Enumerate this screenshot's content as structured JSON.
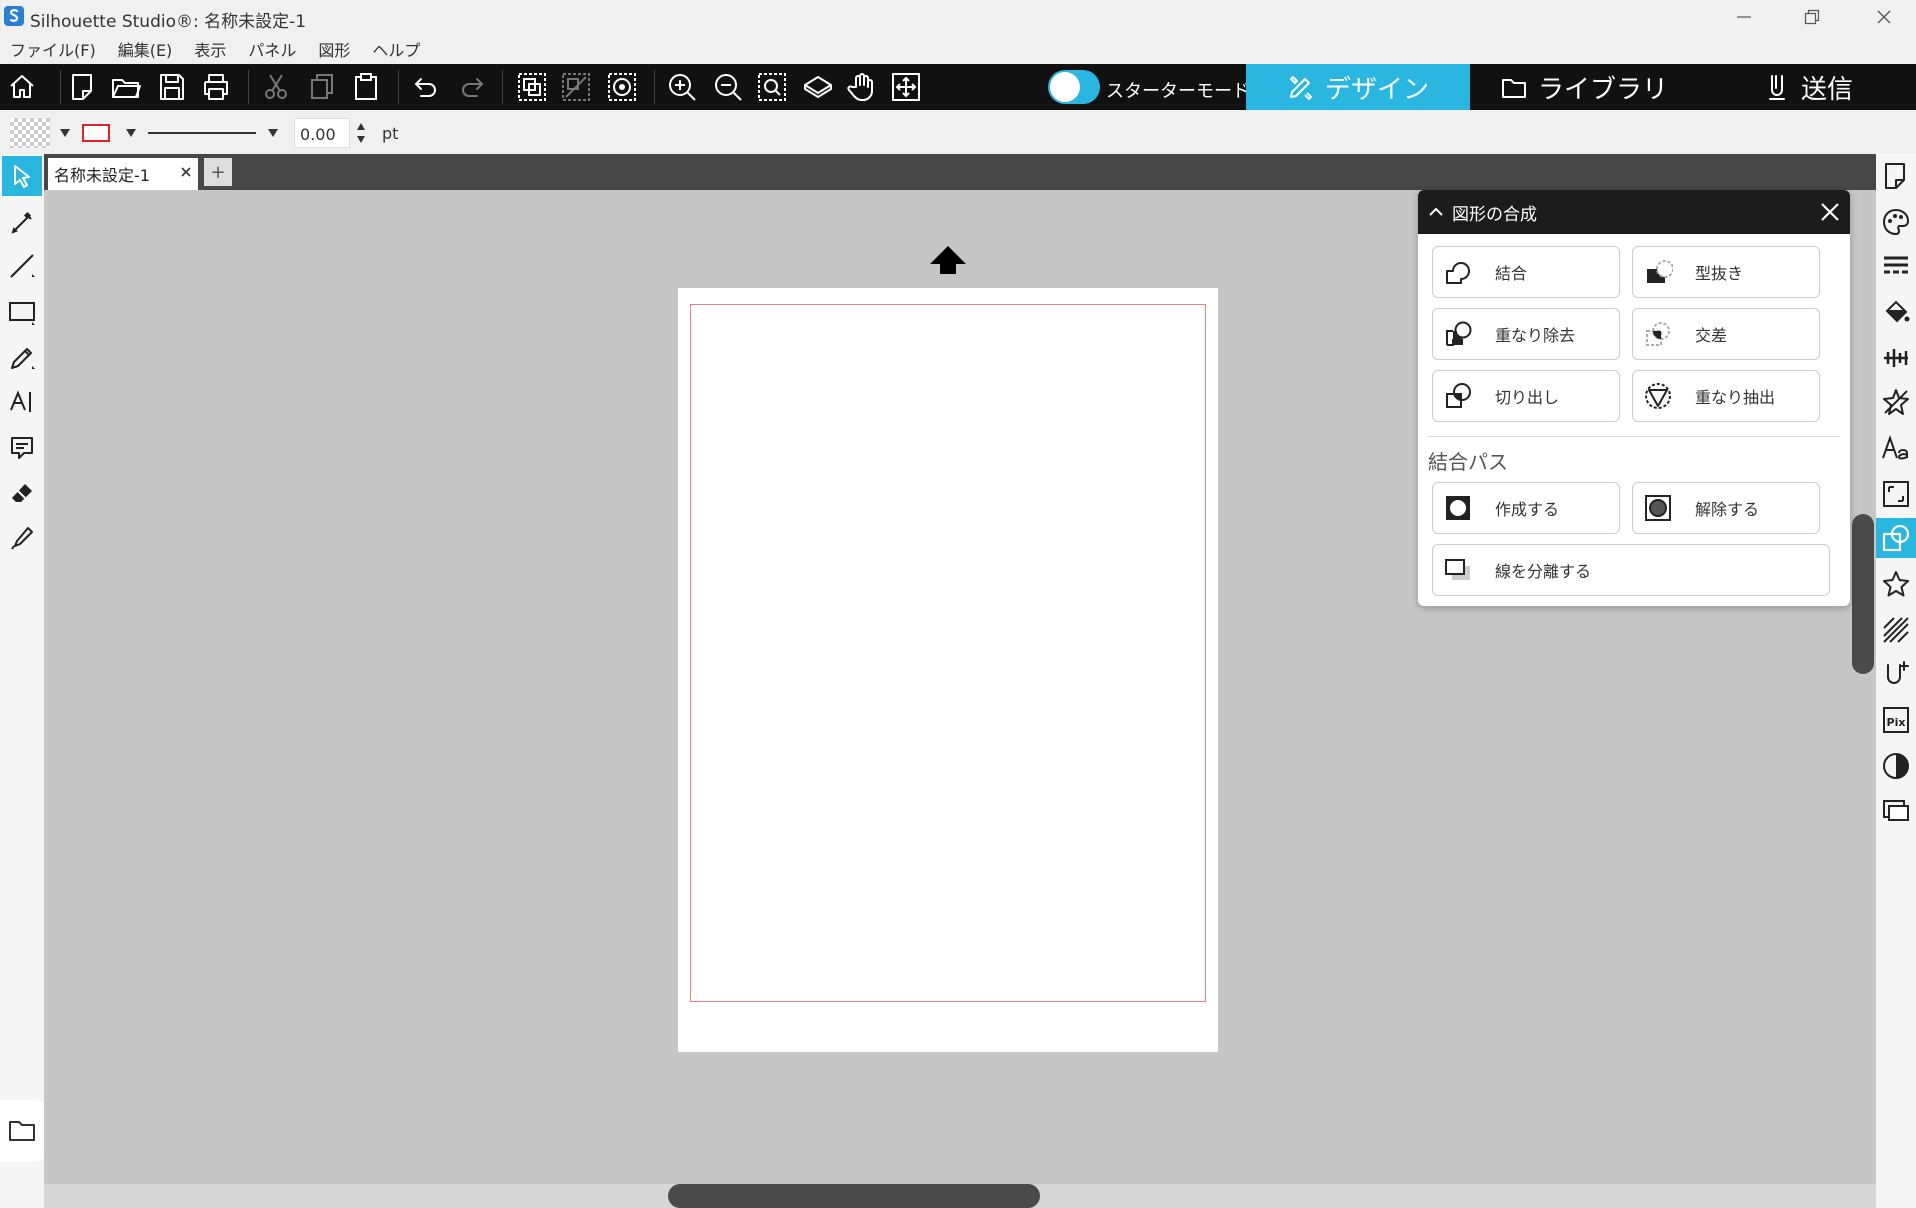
{
  "window": {
    "title": "Silhouette Studio®: 名称未設定-1",
    "controls": [
      "minimize",
      "restore",
      "close"
    ]
  },
  "menu": [
    "ファイル(F)",
    "編集(E)",
    "表示",
    "パネル",
    "図形",
    "ヘルプ"
  ],
  "toolbar": {
    "icons": [
      "home-icon",
      "new-icon",
      "open-icon",
      "save-icon",
      "print-icon",
      "cut-icon",
      "copy-icon",
      "paste-icon",
      "undo-icon",
      "redo-icon",
      "group-icon",
      "ungroup-icon",
      "compound-icon",
      "zoom-in-icon",
      "zoom-out-icon",
      "zoom-select-icon",
      "fit-page-icon",
      "pan-hand-icon",
      "fit-all-icon"
    ],
    "starter_mode_label": "スターターモードオフ",
    "tabs": {
      "design": "デザイン",
      "library": "ライブラリ",
      "send": "送信"
    },
    "accent_color": "#29b6e0"
  },
  "line_settings": {
    "fill_color": "transparent",
    "stroke_color": "#e0232a",
    "width_value": "0.00",
    "unit": "pt"
  },
  "document": {
    "tab_title": "名称未設定-1",
    "add_tab": "+",
    "cut_border_color": "#f08080"
  },
  "modify_panel": {
    "title": "図形の合成",
    "buttons": [
      {
        "label": "結合",
        "icon": "weld-icon"
      },
      {
        "label": "型抜き",
        "icon": "subtract-icon"
      },
      {
        "label": "重なり除去",
        "icon": "subtract-all-icon"
      },
      {
        "label": "交差",
        "icon": "intersect-icon"
      },
      {
        "label": "切り出し",
        "icon": "divide-icon"
      },
      {
        "label": "重なり抽出",
        "icon": "crop-icon"
      }
    ],
    "compound_section": "結合パス",
    "compound_buttons": [
      {
        "label": "作成する",
        "icon": "make-compound-icon"
      },
      {
        "label": "解除する",
        "icon": "release-compound-icon"
      }
    ],
    "separate_button": {
      "label": "線を分離する",
      "icon": "separate-lines-icon"
    }
  }
}
